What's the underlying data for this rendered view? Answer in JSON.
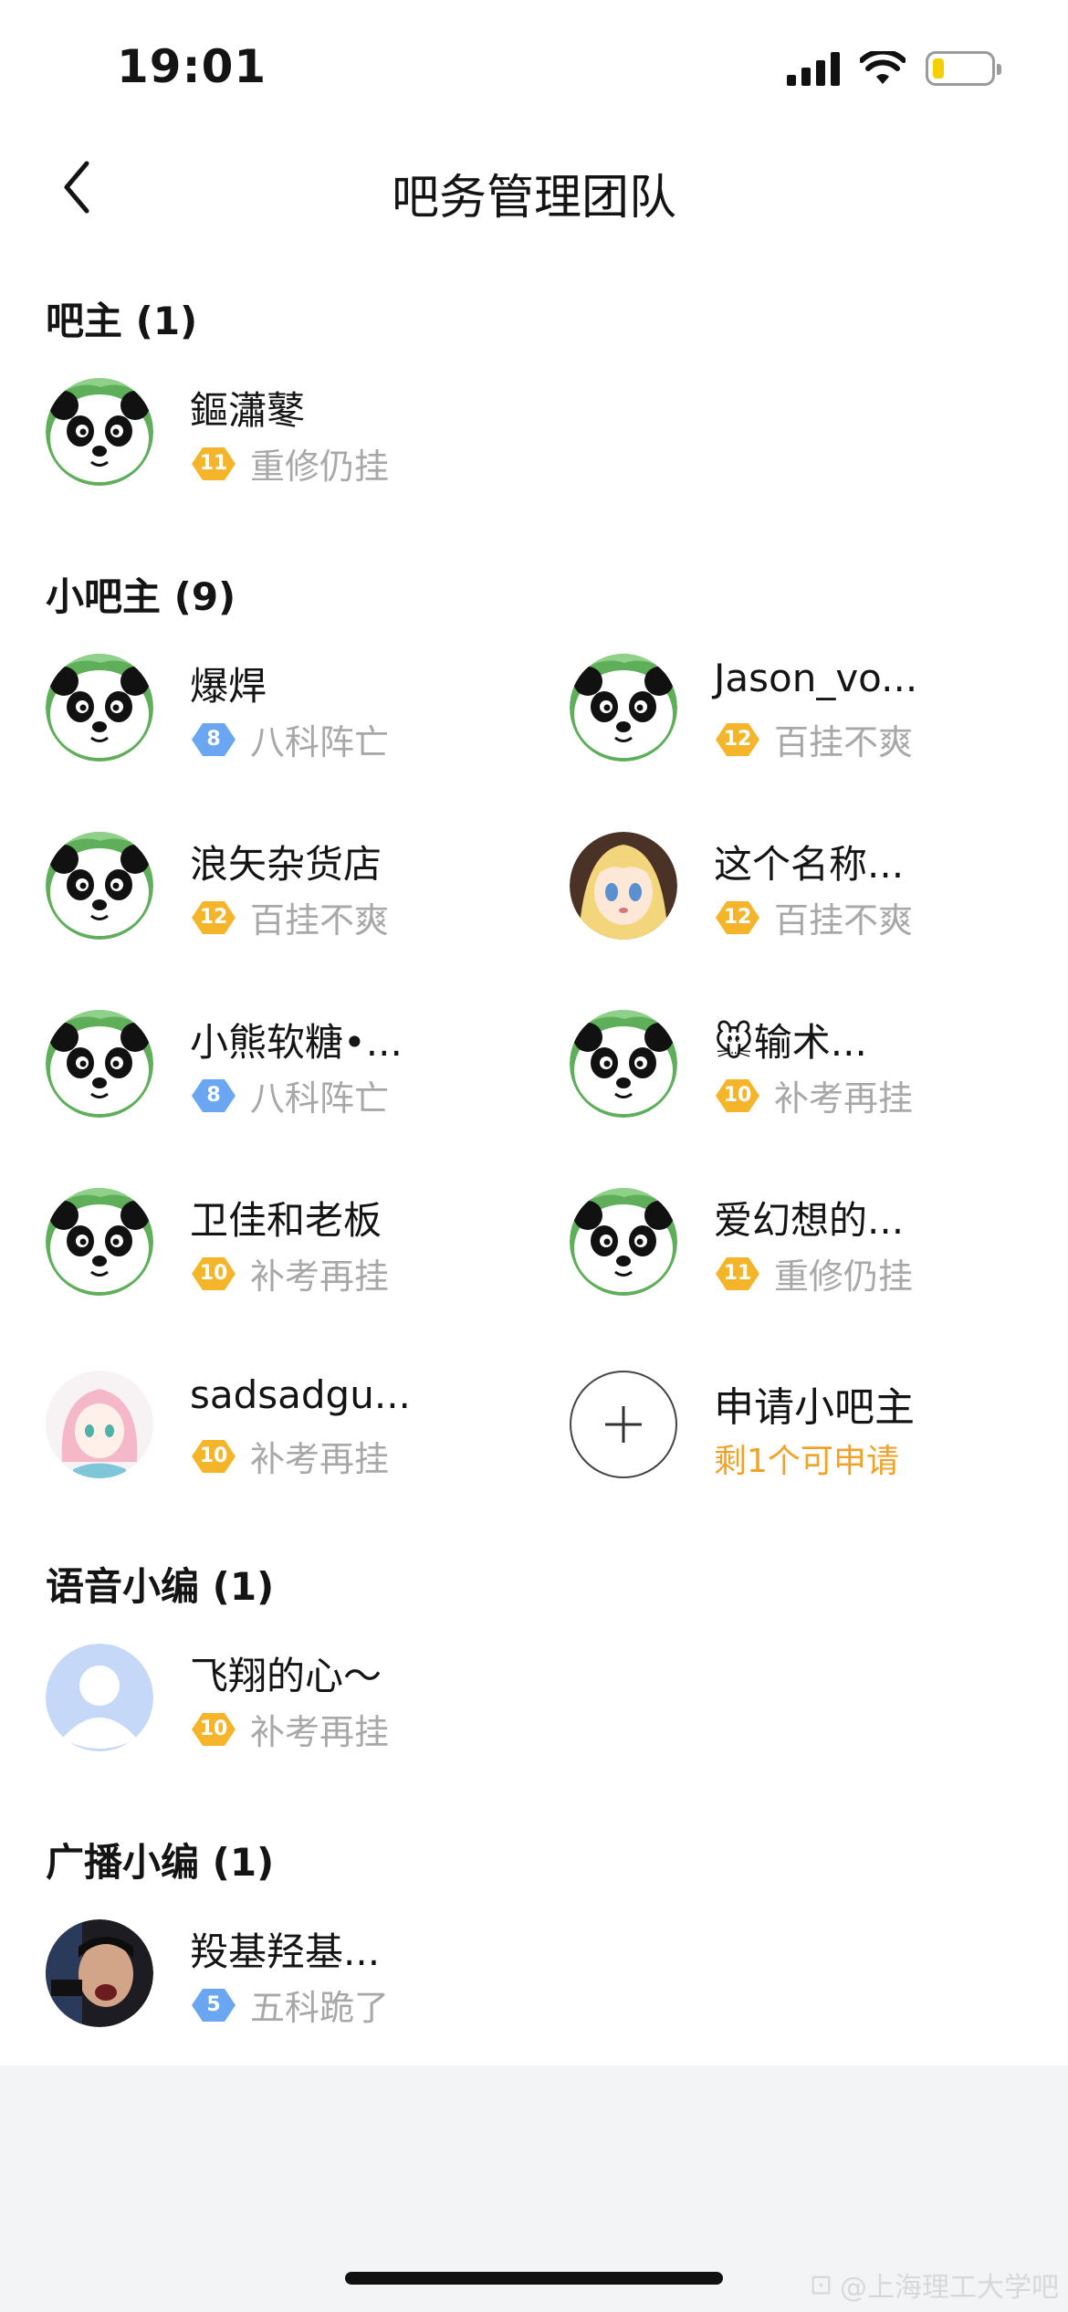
{
  "status": {
    "time": "19:01"
  },
  "nav": {
    "title": "吧务管理团队"
  },
  "sections": {
    "owner": {
      "title": "吧主 (1)"
    },
    "sub_owners": {
      "title": "小吧主 (9)"
    },
    "voice_editors": {
      "title": "语音小编 (1)"
    },
    "broadcast_editors": {
      "title": "广播小编 (1)"
    }
  },
  "owner": [
    {
      "name": "鏂瀟鼕",
      "level": "11",
      "level_title": "重修仍挂",
      "badge_color": "#f5b52a",
      "avatar": "panda-avatar"
    }
  ],
  "sub_owners": [
    {
      "name": "爆焊",
      "level": "8",
      "level_title": "八科阵亡",
      "badge_color": "#6aa6f2",
      "avatar": "panda-avatar"
    },
    {
      "name": "Jason_vo...",
      "level": "12",
      "level_title": "百挂不爽",
      "badge_color": "#f5b52a",
      "avatar": "panda-avatar"
    },
    {
      "name": "浪矢杂货店",
      "level": "12",
      "level_title": "百挂不爽",
      "badge_color": "#f5b52a",
      "avatar": "panda-avatar"
    },
    {
      "name": "这个名称...",
      "level": "12",
      "level_title": "百挂不爽",
      "badge_color": "#f5b52a",
      "avatar": "anime-girl-avatar"
    },
    {
      "name": "小熊软糖•...",
      "level": "8",
      "level_title": "八科阵亡",
      "badge_color": "#6aa6f2",
      "avatar": "panda-avatar"
    },
    {
      "name": "🐭输术...",
      "level": "10",
      "level_title": "补考再挂",
      "badge_color": "#f5b52a",
      "avatar": "panda-avatar"
    },
    {
      "name": "卫佳和老板",
      "level": "10",
      "level_title": "补考再挂",
      "badge_color": "#f5b52a",
      "avatar": "panda-avatar"
    },
    {
      "name": "爱幻想的...",
      "level": "11",
      "level_title": "重修仍挂",
      "badge_color": "#f5b52a",
      "avatar": "panda-avatar"
    },
    {
      "name": "sadsadgu...",
      "level": "10",
      "level_title": "补考再挂",
      "badge_color": "#f5b52a",
      "avatar": "pink-anime-avatar"
    }
  ],
  "apply": {
    "label": "申请小吧主",
    "remaining": "剩1个可申请"
  },
  "voice_editors": [
    {
      "name": "飞翔的心～",
      "level": "10",
      "level_title": "补考再挂",
      "badge_color": "#f5b52a",
      "avatar": "default-avatar"
    }
  ],
  "broadcast_editors": [
    {
      "name": "羖基羟基...",
      "level": "5",
      "level_title": "五科跪了",
      "badge_color": "#6aa6f2",
      "avatar": "photo-avatar"
    }
  ],
  "watermark": "@上海理工大学吧"
}
